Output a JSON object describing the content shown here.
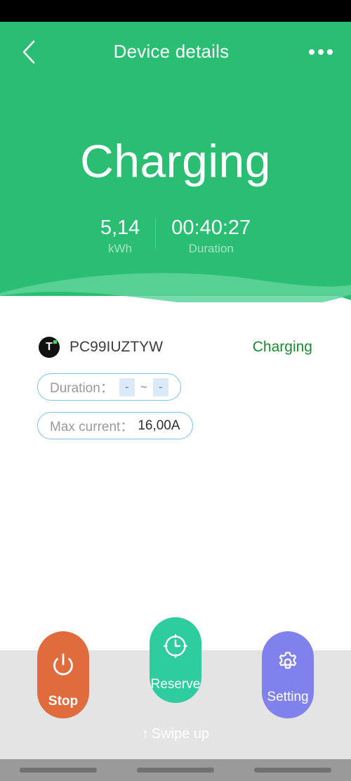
{
  "appbar": {
    "back_icon": "chevron-left-icon",
    "title": "Device details",
    "more_icon": "more-horizontal-icon"
  },
  "hero": {
    "state": "Charging",
    "stats": [
      {
        "value": "5,14",
        "label": "kWh"
      },
      {
        "value": "00:40:27",
        "label": "Duration"
      }
    ]
  },
  "device": {
    "icon": "tuya-logo-icon",
    "icon_letter": "T",
    "id": "PC99IUZTYW",
    "status": "Charging",
    "status_color": "#1a8a2e"
  },
  "fields": {
    "duration": {
      "label": "Duration：",
      "start": "-",
      "separator": "~",
      "end": "-"
    },
    "max_current": {
      "label": "Max current：",
      "value": "16,00A"
    }
  },
  "actions": [
    {
      "name": "stop",
      "label": "Stop",
      "icon": "power-icon",
      "color": "#e06b3c"
    },
    {
      "name": "reserve",
      "label": "Reserve",
      "icon": "clock-icon",
      "color": "#2ecc9e"
    },
    {
      "name": "setting",
      "label": "Setting",
      "icon": "gear-icon",
      "color": "#8181ee"
    }
  ],
  "sheet": {
    "swipe_arrow": "↑",
    "swipe_label": "Swipe up"
  },
  "theme": {
    "hero_green": "#29be72",
    "wave_light": "#5fd49b",
    "pill_border": "#7ec0ee",
    "sheet_gray": "#e4e4e4"
  }
}
